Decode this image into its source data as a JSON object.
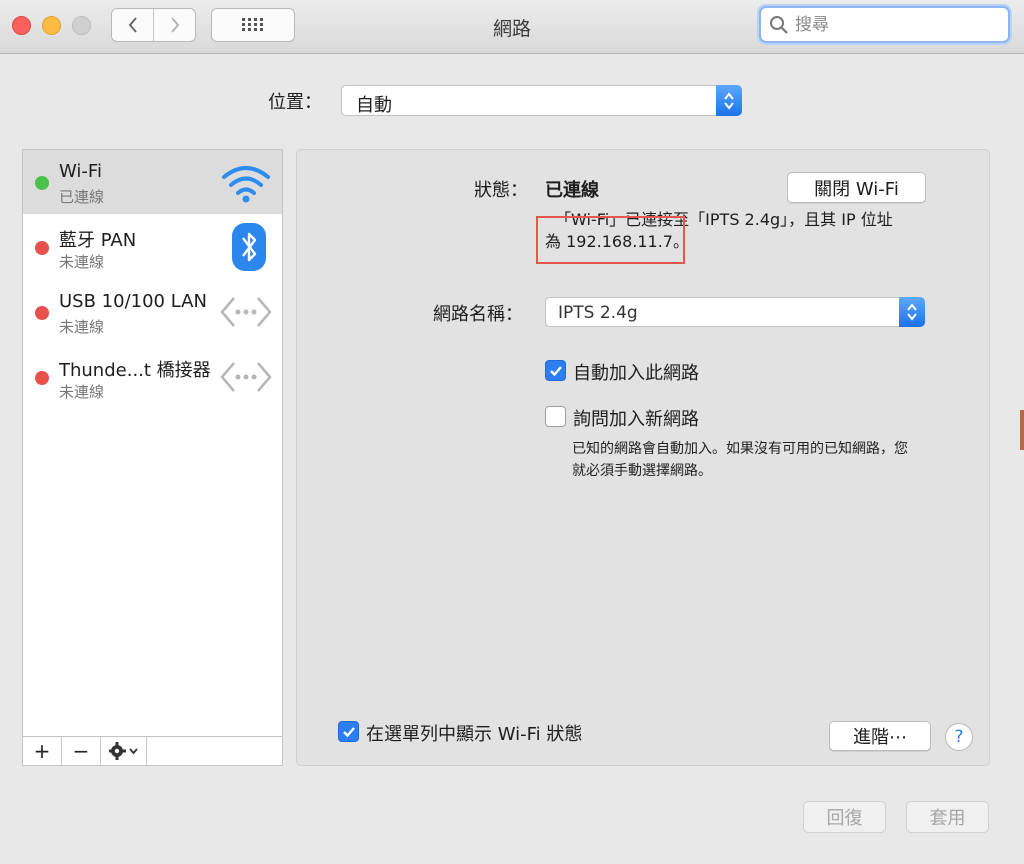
{
  "window": {
    "title": "網路"
  },
  "search": {
    "placeholder": "搜尋"
  },
  "location": {
    "label": "位置：",
    "value": "自動"
  },
  "sidebar": {
    "services": [
      {
        "name": "Wi-Fi",
        "status": "已連線",
        "dot_color": "#4cc04a",
        "icon": "wifi-icon",
        "selected": true
      },
      {
        "name": "藍牙 PAN",
        "status": "未連線",
        "dot_color": "#e8514b",
        "icon": "bluetooth-icon",
        "selected": false
      },
      {
        "name": "USB 10/100 LAN",
        "status": "未連線",
        "dot_color": "#e8514b",
        "icon": "ethernet-icon",
        "selected": false
      },
      {
        "name": "Thunde...t 橋接器",
        "status": "未連線",
        "dot_color": "#e8514b",
        "icon": "ethernet-icon",
        "selected": false
      }
    ],
    "add_label": "+",
    "remove_label": "−"
  },
  "detail": {
    "status_label": "狀態：",
    "status_value": "已連線",
    "turn_off_button": "關閉 Wi-Fi",
    "description_line1": "「Wi-Fi」已連接至「IPTS 2.4g」，且其 IP 位址",
    "description_line2": "為 192.168.11.7。",
    "network_name_label": "網路名稱：",
    "network_name_value": "IPTS 2.4g",
    "auto_join_label": "自動加入此網路",
    "auto_join_checked": true,
    "ask_join_label": "詢問加入新網路",
    "ask_join_checked": false,
    "note": "已知的網路會自動加入。如果沒有可用的已知網路，您就必須手動選擇網路。",
    "show_status_label": "在選單列中顯示 Wi-Fi 狀態",
    "show_status_checked": true,
    "advanced_button": "進階⋯",
    "help_label": "?"
  },
  "footer": {
    "revert_button": "回復",
    "apply_button": "套用"
  },
  "colors": {
    "accent": "#2d7ef2",
    "annotation": "#e5584c"
  }
}
